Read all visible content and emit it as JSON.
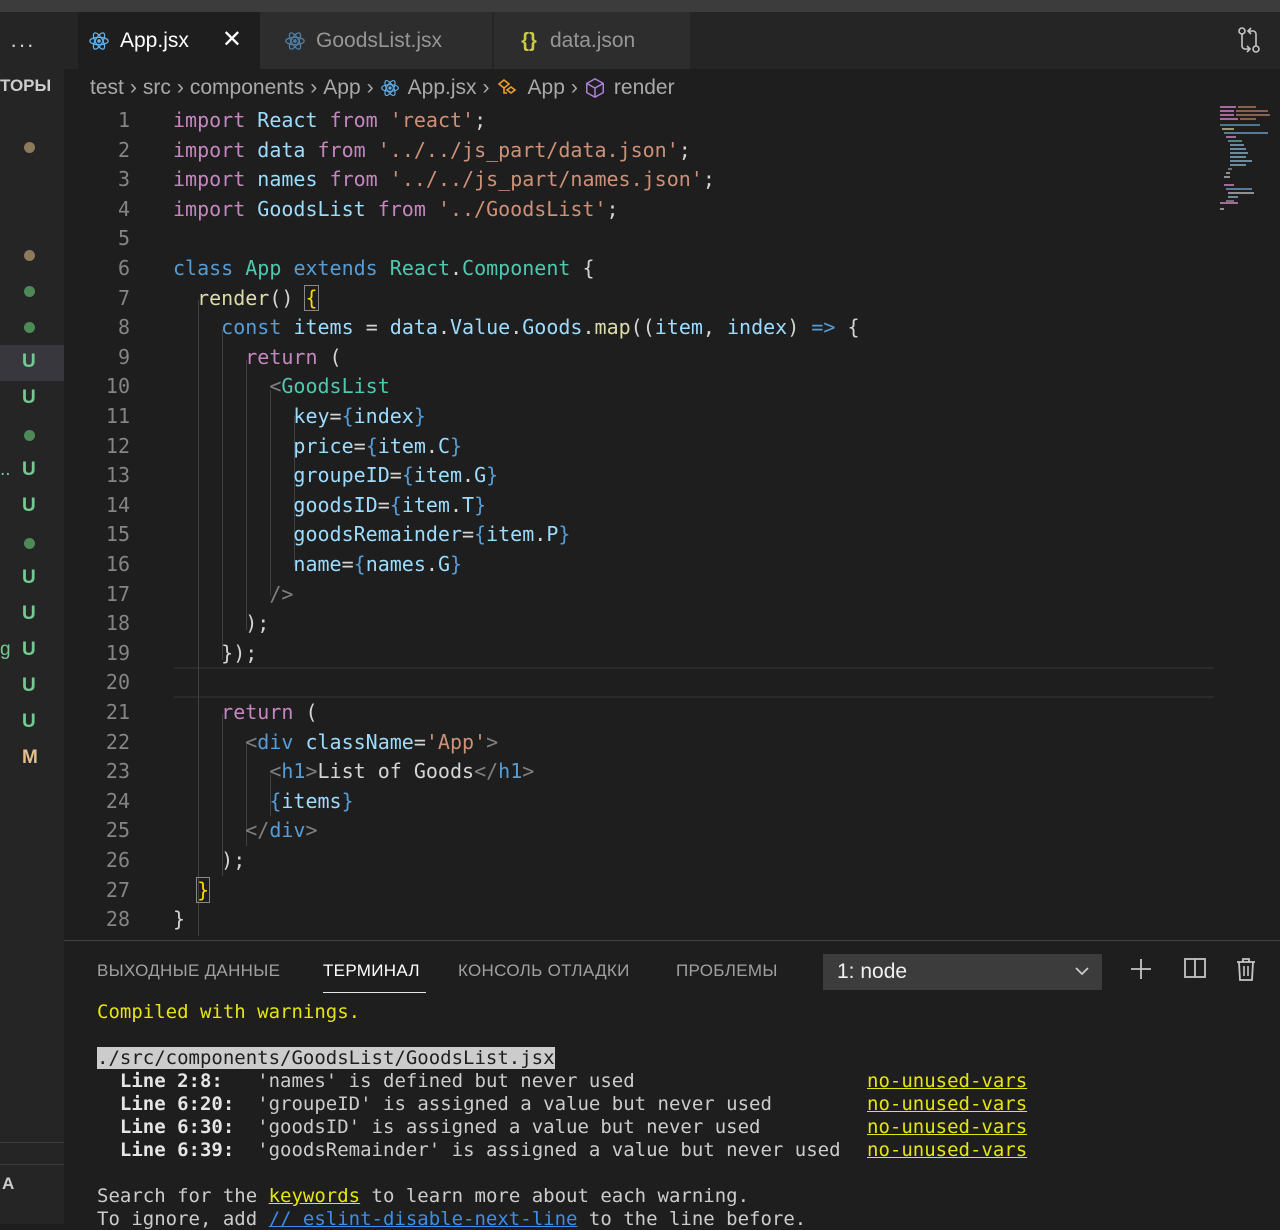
{
  "sidebar": {
    "heading": "ТОРЫ",
    "footer": "А",
    "rows": [
      {
        "kind": "dot",
        "color": "#8c7a5b"
      },
      {
        "kind": "dot",
        "color": "#8c7a5b"
      },
      {
        "kind": "dot",
        "color": "#4d8a57"
      },
      {
        "kind": "dot",
        "color": "#4d8a57"
      },
      {
        "kind": "status",
        "text": "U",
        "color": "#73c991"
      },
      {
        "kind": "status",
        "text": "U",
        "color": "#73c991"
      },
      {
        "kind": "dot",
        "color": "#4d8a57"
      },
      {
        "kind": "status",
        "text": "U",
        "color": "#73c991",
        "prefix": ".."
      },
      {
        "kind": "status",
        "text": "U",
        "color": "#73c991"
      },
      {
        "kind": "dot",
        "color": "#4d8a57"
      },
      {
        "kind": "status",
        "text": "U",
        "color": "#73c991"
      },
      {
        "kind": "status",
        "text": "U",
        "color": "#73c991"
      },
      {
        "kind": "status",
        "text": "U",
        "color": "#73c991",
        "prefix": "g"
      },
      {
        "kind": "status",
        "text": "U",
        "color": "#73c991"
      },
      {
        "kind": "status",
        "text": "U",
        "color": "#73c991"
      },
      {
        "kind": "status",
        "text": "M",
        "color": "#e2c08d"
      }
    ]
  },
  "tabs": [
    {
      "label": "App.jsx",
      "icon": "react-icon",
      "active": true
    },
    {
      "label": "GoodsList.jsx",
      "icon": "react-icon",
      "active": false
    },
    {
      "label": "data.json",
      "icon": "json-braces-icon",
      "active": false
    }
  ],
  "breadcrumb": [
    "test",
    "src",
    "components",
    "App",
    "App.jsx",
    "App",
    "render"
  ],
  "editor": {
    "line_numbers": [
      "1",
      "2",
      "3",
      "4",
      "5",
      "6",
      "7",
      "8",
      "9",
      "10",
      "11",
      "12",
      "13",
      "14",
      "15",
      "16",
      "17",
      "18",
      "19",
      "20",
      "21",
      "22",
      "23",
      "24",
      "25",
      "26",
      "27",
      "28"
    ],
    "lines": [
      [
        [
          "k",
          "import"
        ],
        [
          "p",
          " "
        ],
        [
          "v",
          "React"
        ],
        [
          "p",
          " "
        ],
        [
          "k",
          "from"
        ],
        [
          "p",
          " "
        ],
        [
          "s",
          "'react'"
        ],
        [
          "p",
          ";"
        ]
      ],
      [
        [
          "k",
          "import"
        ],
        [
          "p",
          " "
        ],
        [
          "v",
          "data"
        ],
        [
          "p",
          " "
        ],
        [
          "k",
          "from"
        ],
        [
          "p",
          " "
        ],
        [
          "s",
          "'../../js_part/data.json'"
        ],
        [
          "p",
          ";"
        ]
      ],
      [
        [
          "k",
          "import"
        ],
        [
          "p",
          " "
        ],
        [
          "v",
          "names"
        ],
        [
          "p",
          " "
        ],
        [
          "k",
          "from"
        ],
        [
          "p",
          " "
        ],
        [
          "s",
          "'../../js_part/names.json'"
        ],
        [
          "p",
          ";"
        ]
      ],
      [
        [
          "k",
          "import"
        ],
        [
          "p",
          " "
        ],
        [
          "v",
          "GoodsList"
        ],
        [
          "p",
          " "
        ],
        [
          "k",
          "from"
        ],
        [
          "p",
          " "
        ],
        [
          "s",
          "'../GoodsList'"
        ],
        [
          "p",
          ";"
        ]
      ],
      [],
      [
        [
          "b",
          "class"
        ],
        [
          "p",
          " "
        ],
        [
          "t",
          "App"
        ],
        [
          "p",
          " "
        ],
        [
          "b",
          "extends"
        ],
        [
          "p",
          " "
        ],
        [
          "t",
          "React"
        ],
        [
          "p",
          "."
        ],
        [
          "t",
          "Component"
        ],
        [
          "p",
          " {"
        ]
      ],
      [
        [
          "p",
          "  "
        ],
        [
          "f",
          "render"
        ],
        [
          "p",
          "() "
        ],
        [
          "br",
          "{"
        ]
      ],
      [
        [
          "p",
          "    "
        ],
        [
          "b",
          "const"
        ],
        [
          "p",
          " "
        ],
        [
          "v",
          "items"
        ],
        [
          "p",
          " = "
        ],
        [
          "v",
          "data"
        ],
        [
          "p",
          "."
        ],
        [
          "v",
          "Value"
        ],
        [
          "p",
          "."
        ],
        [
          "v",
          "Goods"
        ],
        [
          "p",
          "."
        ],
        [
          "f",
          "map"
        ],
        [
          "p",
          "(("
        ],
        [
          "v",
          "item"
        ],
        [
          "p",
          ", "
        ],
        [
          "v",
          "index"
        ],
        [
          "p",
          ") "
        ],
        [
          "b",
          "=>"
        ],
        [
          "p",
          " {"
        ]
      ],
      [
        [
          "p",
          "      "
        ],
        [
          "k",
          "return"
        ],
        [
          "p",
          " ("
        ]
      ],
      [
        [
          "p",
          "        "
        ],
        [
          "tg",
          "<"
        ],
        [
          "t",
          "GoodsList"
        ]
      ],
      [
        [
          "p",
          "          "
        ],
        [
          "v",
          "key"
        ],
        [
          "p",
          "="
        ],
        [
          "b",
          "{"
        ],
        [
          "v",
          "index"
        ],
        [
          "b",
          "}"
        ]
      ],
      [
        [
          "p",
          "          "
        ],
        [
          "v",
          "price"
        ],
        [
          "p",
          "="
        ],
        [
          "b",
          "{"
        ],
        [
          "v",
          "item"
        ],
        [
          "p",
          "."
        ],
        [
          "v",
          "C"
        ],
        [
          "b",
          "}"
        ]
      ],
      [
        [
          "p",
          "          "
        ],
        [
          "v",
          "groupeID"
        ],
        [
          "p",
          "="
        ],
        [
          "b",
          "{"
        ],
        [
          "v",
          "item"
        ],
        [
          "p",
          "."
        ],
        [
          "v",
          "G"
        ],
        [
          "b",
          "}"
        ]
      ],
      [
        [
          "p",
          "          "
        ],
        [
          "v",
          "goodsID"
        ],
        [
          "p",
          "="
        ],
        [
          "b",
          "{"
        ],
        [
          "v",
          "item"
        ],
        [
          "p",
          "."
        ],
        [
          "v",
          "T"
        ],
        [
          "b",
          "}"
        ]
      ],
      [
        [
          "p",
          "          "
        ],
        [
          "v",
          "goodsRemainder"
        ],
        [
          "p",
          "="
        ],
        [
          "b",
          "{"
        ],
        [
          "v",
          "item"
        ],
        [
          "p",
          "."
        ],
        [
          "v",
          "P"
        ],
        [
          "b",
          "}"
        ]
      ],
      [
        [
          "p",
          "          "
        ],
        [
          "v",
          "name"
        ],
        [
          "p",
          "="
        ],
        [
          "b",
          "{"
        ],
        [
          "v",
          "names"
        ],
        [
          "p",
          "."
        ],
        [
          "v",
          "G"
        ],
        [
          "b",
          "}"
        ]
      ],
      [
        [
          "p",
          "        "
        ],
        [
          "tg",
          "/>"
        ]
      ],
      [
        [
          "p",
          "      );"
        ]
      ],
      [
        [
          "p",
          "    });"
        ]
      ],
      [],
      [
        [
          "p",
          "    "
        ],
        [
          "k",
          "return"
        ],
        [
          "p",
          " ("
        ]
      ],
      [
        [
          "p",
          "      "
        ],
        [
          "tg",
          "<"
        ],
        [
          "b",
          "div"
        ],
        [
          "p",
          " "
        ],
        [
          "v",
          "className"
        ],
        [
          "p",
          "="
        ],
        [
          "s",
          "'App'"
        ],
        [
          "tg",
          ">"
        ]
      ],
      [
        [
          "p",
          "        "
        ],
        [
          "tg",
          "<"
        ],
        [
          "b",
          "h1"
        ],
        [
          "tg",
          ">"
        ],
        [
          "p",
          "List of Goods"
        ],
        [
          "tg",
          "</"
        ],
        [
          "b",
          "h1"
        ],
        [
          "tg",
          ">"
        ]
      ],
      [
        [
          "p",
          "        "
        ],
        [
          "b",
          "{"
        ],
        [
          "v",
          "items"
        ],
        [
          "b",
          "}"
        ]
      ],
      [
        [
          "p",
          "      "
        ],
        [
          "tg",
          "</"
        ],
        [
          "b",
          "div"
        ],
        [
          "tg",
          ">"
        ]
      ],
      [
        [
          "p",
          "    );"
        ]
      ],
      [
        [
          "p",
          "  "
        ],
        [
          "br",
          "}"
        ]
      ],
      [
        [
          "p",
          "}"
        ]
      ]
    ]
  },
  "panel": {
    "tabs": [
      "ВЫХОДНЫЕ ДАННЫЕ",
      "ТЕРМИНАЛ",
      "КОНСОЛЬ ОТЛАДКИ",
      "ПРОБЛЕМЫ"
    ],
    "active_tab": "ТЕРМИНАЛ",
    "terminal_select": "1: node",
    "icons": [
      "plus-icon",
      "split-icon",
      "trash-icon"
    ]
  },
  "terminal": {
    "compiled": "Compiled with warnings.",
    "file": "./src/components/GoodsList/GoodsList.jsx",
    "warnings": [
      {
        "loc": "Line 2:8:",
        "msg": "'names' is defined but never used",
        "rule": "no-unused-vars"
      },
      {
        "loc": "Line 6:20:",
        "msg": "'groupeID' is assigned a value but never used",
        "rule": "no-unused-vars"
      },
      {
        "loc": "Line 6:30:",
        "msg": "'goodsID' is assigned a value but never used",
        "rule": "no-unused-vars"
      },
      {
        "loc": "Line 6:39:",
        "msg": "'goodsRemainder' is assigned a value but never used",
        "rule": "no-unused-vars"
      }
    ],
    "search_pre": "Search for the ",
    "search_link": "keywords",
    "search_post": " to learn more about each warning.",
    "ignore_pre": "To ignore, add ",
    "ignore_link": "// eslint-disable-next-line",
    "ignore_post": " to the line before."
  }
}
